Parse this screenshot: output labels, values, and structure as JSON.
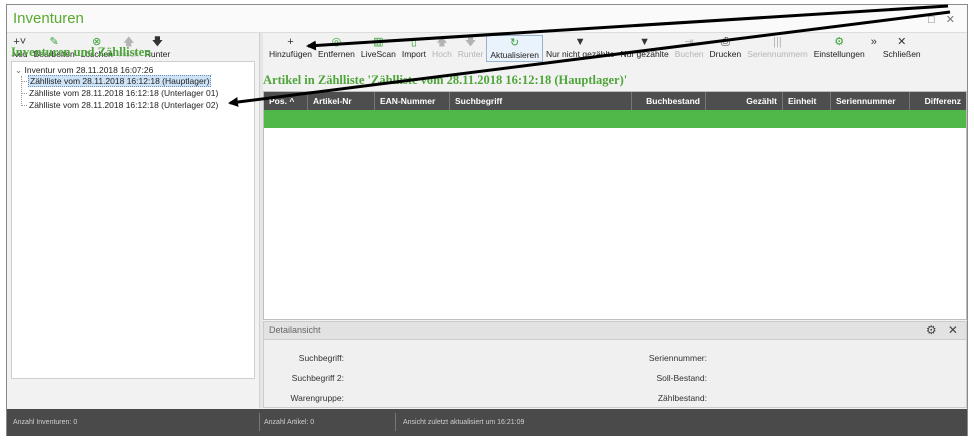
{
  "window": {
    "title": "Inventuren",
    "controls": "□ ✕"
  },
  "left_toolbar": [
    {
      "label": "Neu",
      "icon": "+˅",
      "disabled": false
    },
    {
      "label": "Bearbeiten",
      "icon": "✎",
      "disabled": false
    },
    {
      "label": "Löschen",
      "icon": "⊗",
      "disabled": false
    },
    {
      "label": "Hoch",
      "icon": "🡅",
      "disabled": true
    },
    {
      "label": "Runter",
      "icon": "🡇",
      "disabled": false
    }
  ],
  "right_toolbar": [
    {
      "label": "Hinzufügen",
      "icon": "+",
      "disabled": false
    },
    {
      "label": "Entfernen",
      "icon": "◎",
      "disabled": false
    },
    {
      "label": "LiveScan",
      "icon": "▥",
      "disabled": false
    },
    {
      "label": "Import",
      "icon": "▯",
      "disabled": false
    },
    {
      "label": "Hoch",
      "icon": "🡅",
      "disabled": true
    },
    {
      "label": "Runter",
      "icon": "🡇",
      "disabled": true
    },
    {
      "label": "Aktualisieren",
      "icon": "↻",
      "disabled": false
    },
    {
      "label": "Nur nicht gezählte",
      "icon": "▼",
      "disabled": false
    },
    {
      "label": "Nur gezählte",
      "icon": "▼",
      "disabled": false
    },
    {
      "label": "Buchen",
      "icon": "⇥",
      "disabled": true
    },
    {
      "label": "Drucken",
      "icon": "⎙",
      "disabled": false
    },
    {
      "label": "Seriennummern",
      "icon": "|||",
      "disabled": true
    },
    {
      "label": "Einstellungen",
      "icon": "⚙",
      "disabled": false
    },
    {
      "label": "Schließen",
      "icon": "✕",
      "disabled": false
    }
  ],
  "more_icon": "»",
  "left_heading": "Inventuren und Zähllisten",
  "tree": {
    "root": "Inventur vom 28.11.2018 16:07:26",
    "children": [
      "Zählliste vom 28.11.2018 16:12:18 (Hauptlager)",
      "Zählliste vom 28.11.2018 16:12:18 (Unterlager 01)",
      "Zählliste vom 28.11.2018 16:12:18 (Unterlager 02)"
    ]
  },
  "right_heading": "Artikel in Zählliste 'Zählliste vom 28.11.2018 16:12:18 (Hauptlager)'",
  "grid": {
    "columns": [
      "Pos.",
      "Artikel-Nr",
      "EAN-Nummer",
      "Suchbegriff",
      "Buchbestand",
      "Gezählt",
      "Einheit",
      "Seriennummer",
      "Differenz"
    ],
    "sort_indicator": "^"
  },
  "detail": {
    "title": "Detailansicht",
    "icons": "⚙ ✕",
    "labels_left": [
      "Suchbegriff:",
      "Suchbegriff 2:",
      "Warengruppe:"
    ],
    "labels_right": [
      "Seriennummer:",
      "Soll-Bestand:",
      "Zählbestand:"
    ]
  },
  "status": {
    "left": "Anzahl Inventuren: 0",
    "middle": "Anzahl Artikel: 0",
    "right": "Ansicht zuletzt aktualisiert um 16:21:09"
  },
  "colors": {
    "accent": "#4ea53a",
    "header": "#4e4e4e",
    "selected_row": "#4fb848",
    "statusbar": "#4a4a4a"
  }
}
